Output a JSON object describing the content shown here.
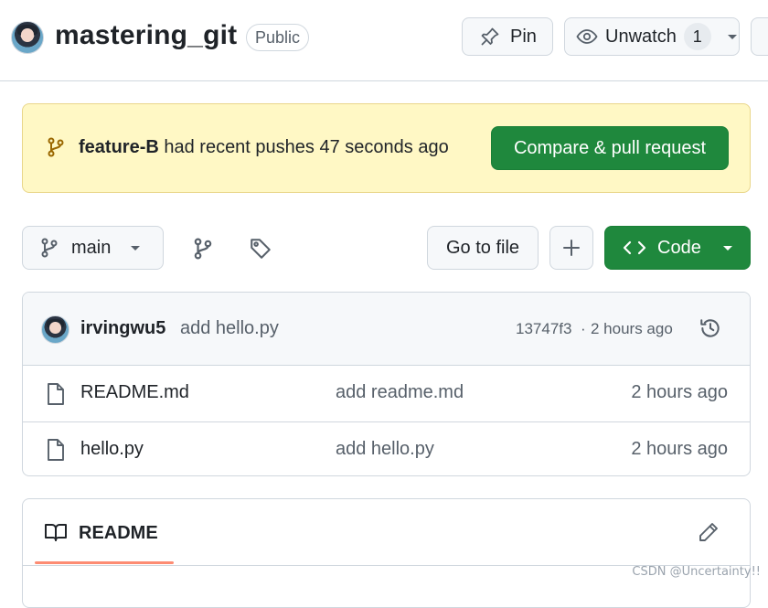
{
  "header": {
    "repo_name": "mastering_git",
    "visibility": "Public",
    "pin_label": "Pin",
    "watch_label": "Unwatch",
    "watch_count": "1"
  },
  "banner": {
    "branch": "feature-B",
    "message": " had recent pushes 47 seconds ago",
    "compare_label": "Compare & pull request"
  },
  "toolbar": {
    "branch_label": "main",
    "goto_file_label": "Go to file",
    "add_label": "+",
    "code_label": "Code"
  },
  "commit": {
    "author": "irvingwu5",
    "message": "add hello.py",
    "hash": "13747f3",
    "separator": "·",
    "time": "2 hours ago"
  },
  "files": [
    {
      "name": "README.md",
      "commit_message": "add readme.md",
      "time": "2 hours ago"
    },
    {
      "name": "hello.py",
      "commit_message": "add hello.py",
      "time": "2 hours ago"
    }
  ],
  "readme": {
    "title": "README"
  },
  "watermark": "CSDN @Uncertainty!!",
  "colors": {
    "accent_green": "#1f883d",
    "banner_bg": "#fff8c5",
    "tab_underline": "#fd8c73"
  }
}
